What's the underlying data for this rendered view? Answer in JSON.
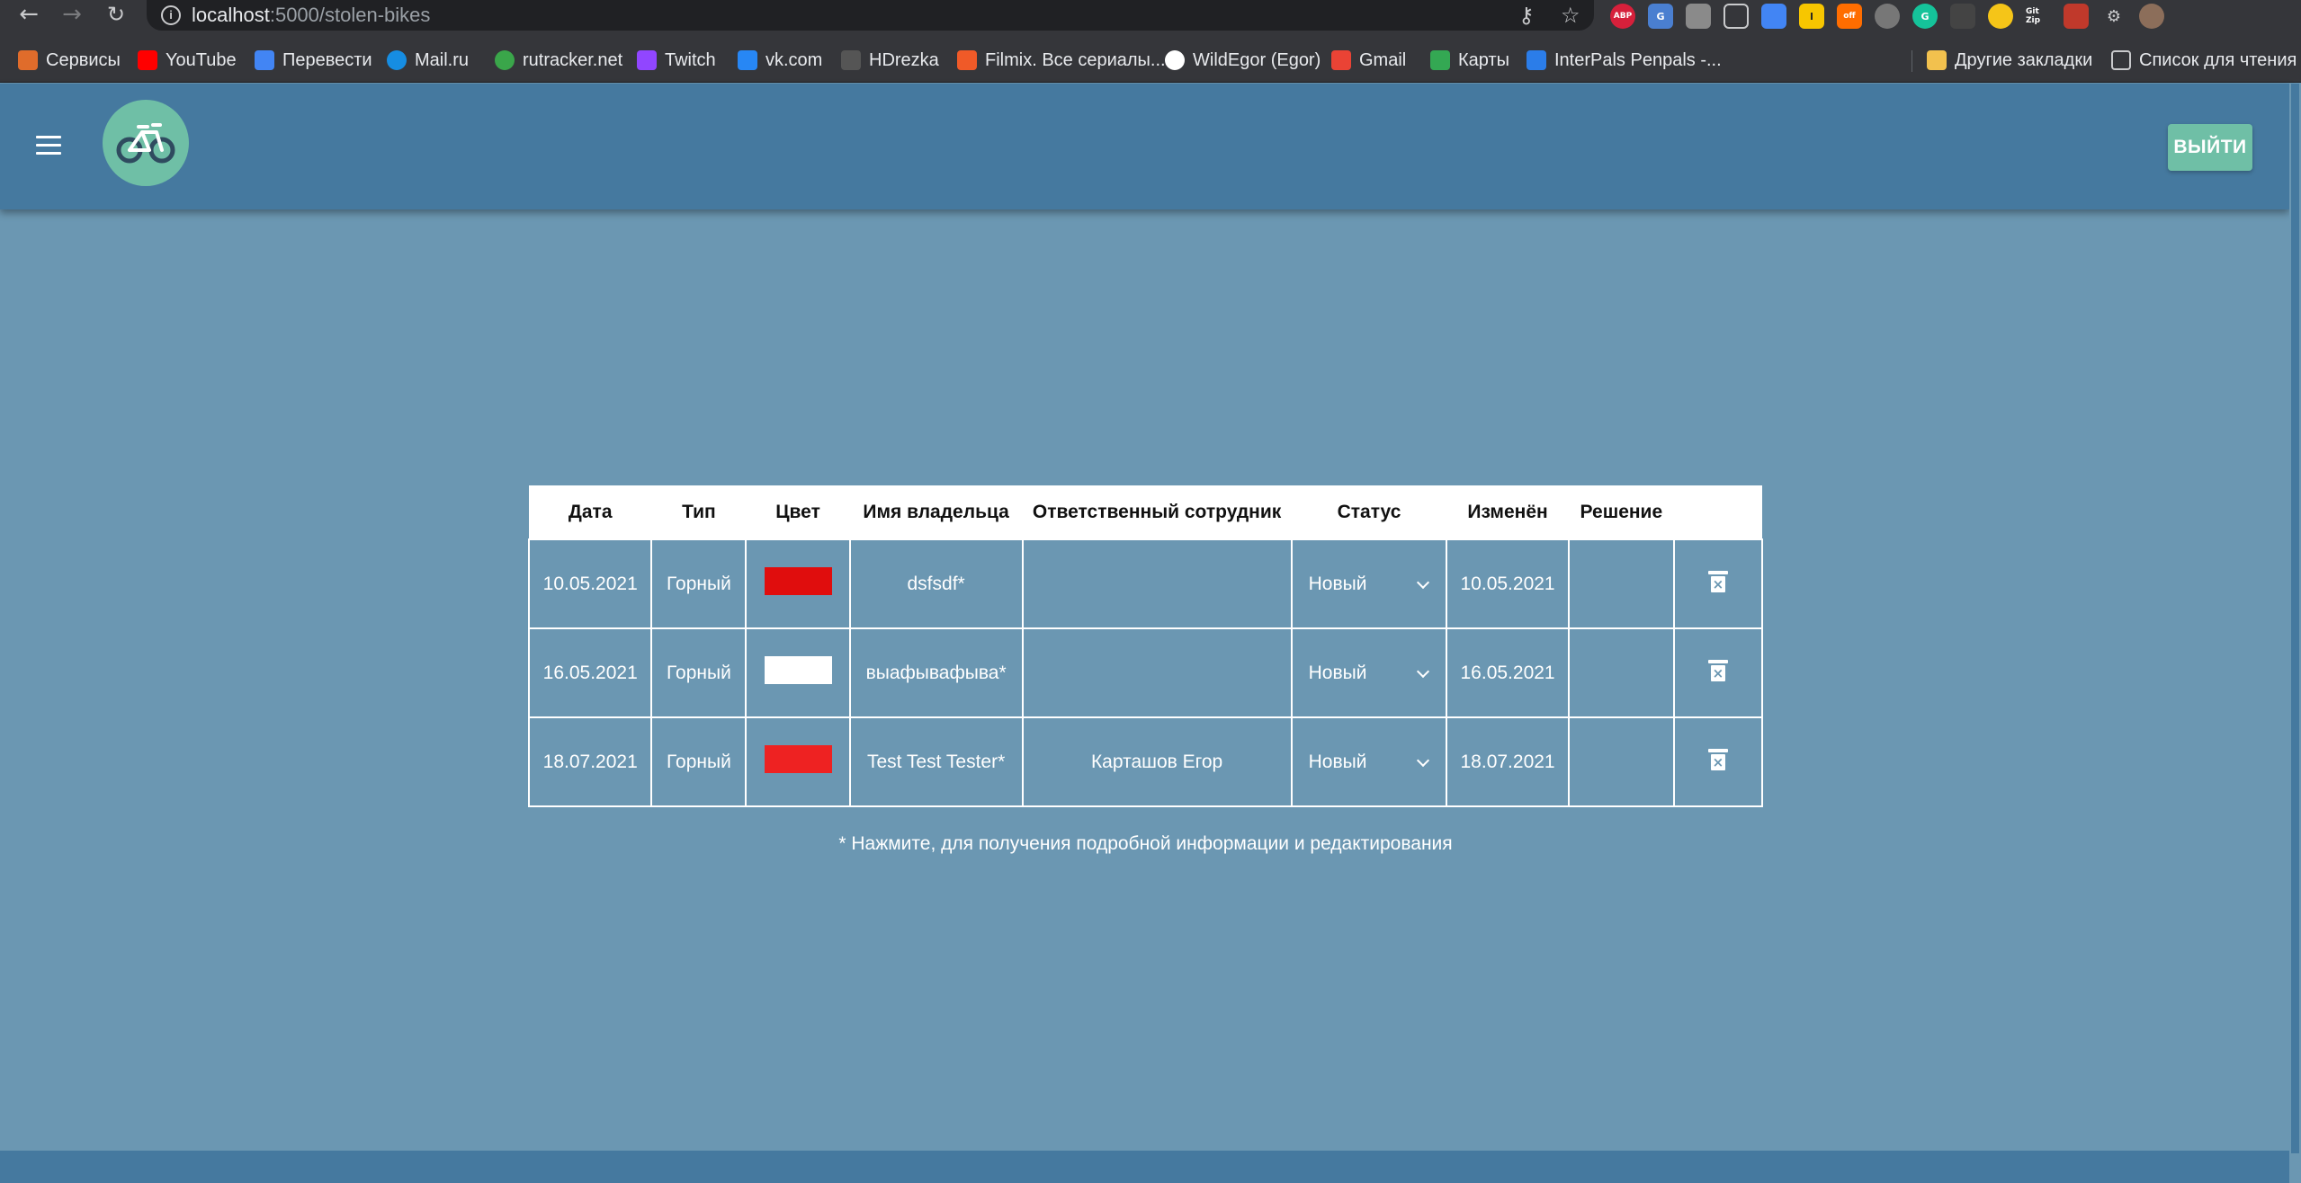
{
  "browser": {
    "url_host": "localhost",
    "url_path": ":5000/stolen-bikes",
    "bookmarks": [
      {
        "label": "Сервисы",
        "color": "#e06c2b"
      },
      {
        "label": "YouTube",
        "color": "#ff0000"
      },
      {
        "label": "Перевести",
        "color": "#4285f4"
      },
      {
        "label": "Mail.ru",
        "color": "#168de2"
      },
      {
        "label": "rutracker.net",
        "color": "#3aa64a"
      },
      {
        "label": "Twitch",
        "color": "#9146ff"
      },
      {
        "label": "vk.com",
        "color": "#2787f5"
      },
      {
        "label": "HDrezka",
        "color": "#555555"
      },
      {
        "label": "Filmix. Все сериалы...",
        "color": "#f05a28"
      },
      {
        "label": "WildEgor (Egor)",
        "color": "#ffffff"
      },
      {
        "label": "Gmail",
        "color": "#ea4335"
      },
      {
        "label": "Карты",
        "color": "#34a853"
      },
      {
        "label": "InterPals Penpals -...",
        "color": "#2b7de9"
      }
    ],
    "other_bookmarks": "Другие закладки",
    "reading_list": "Список для чтения",
    "extensions": [
      "ABP",
      "G",
      "",
      "",
      "",
      "I",
      "off",
      "",
      "G",
      "",
      "",
      "Git Zip",
      "",
      "",
      ""
    ]
  },
  "header": {
    "menu_icon": "menu-icon",
    "logo_icon": "bike-icon",
    "logout_label": "ВЫЙТИ"
  },
  "table": {
    "columns": [
      "Дата",
      "Тип",
      "Цвет",
      "Имя владельца",
      "Ответственный сотрудник",
      "Статус",
      "Изменён",
      "Решение",
      ""
    ],
    "rows": [
      {
        "date": "10.05.2021",
        "type": "Горный",
        "color": "#e00d0d",
        "owner": "dsfsdf*",
        "officer": "",
        "status": "Новый",
        "changed": "10.05.2021",
        "resolution": ""
      },
      {
        "date": "16.05.2021",
        "type": "Горный",
        "color": "#ffffff",
        "owner": "выафывафыва*",
        "officer": "",
        "status": "Новый",
        "changed": "16.05.2021",
        "resolution": ""
      },
      {
        "date": "18.07.2021",
        "type": "Горный",
        "color": "#ee2222",
        "owner": "Test Test Tester*",
        "officer": "Карташов Егор",
        "status": "Новый",
        "changed": "18.07.2021",
        "resolution": ""
      }
    ]
  },
  "note": "* Нажмите, для получения подробной информации и редактирования"
}
